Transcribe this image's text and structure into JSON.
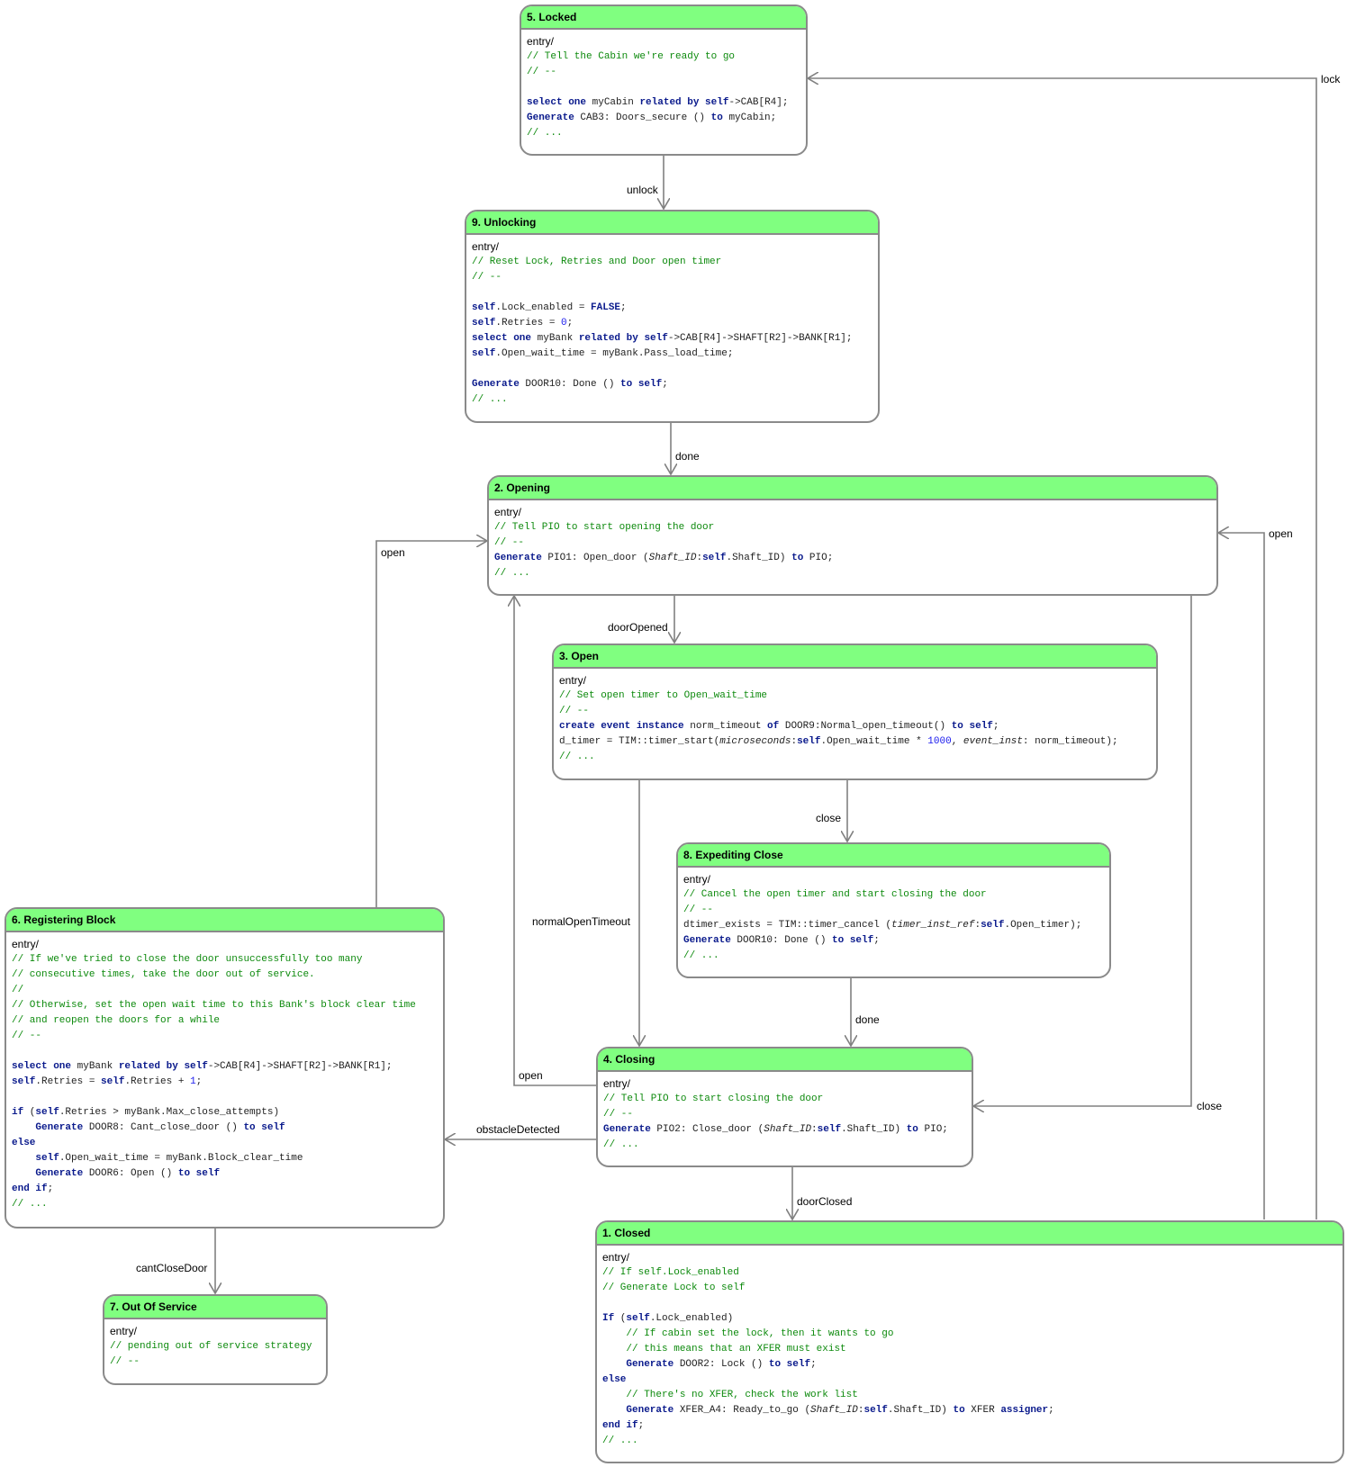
{
  "entry_label": "entry/",
  "states": [
    {
      "id": "locked",
      "title": "5. Locked",
      "code": [
        [
          [
            "c",
            "// Tell the Cabin we're ready to go"
          ]
        ],
        [
          [
            "c",
            "// --"
          ]
        ],
        [],
        [
          [
            "k",
            "select one"
          ],
          [
            "t",
            " myCabin "
          ],
          [
            "k",
            "related by self"
          ],
          [
            "t",
            "->CAB[R4];"
          ]
        ],
        [
          [
            "k",
            "Generate"
          ],
          [
            "t",
            " CAB3: Doors_secure () "
          ],
          [
            "k",
            "to"
          ],
          [
            "t",
            " myCabin;"
          ]
        ],
        [
          [
            "c",
            "// ..."
          ]
        ]
      ]
    },
    {
      "id": "unlocking",
      "title": "9. Unlocking",
      "code": [
        [
          [
            "c",
            "// Reset Lock, Retries and Door open timer"
          ]
        ],
        [
          [
            "c",
            "// --"
          ]
        ],
        [],
        [
          [
            "k",
            "self"
          ],
          [
            "t",
            ".Lock_enabled = "
          ],
          [
            "k",
            "FALSE"
          ],
          [
            "t",
            ";"
          ]
        ],
        [
          [
            "k",
            "self"
          ],
          [
            "t",
            ".Retries = "
          ],
          [
            "n",
            "0"
          ],
          [
            "t",
            ";"
          ]
        ],
        [
          [
            "k",
            "select one"
          ],
          [
            "t",
            " myBank "
          ],
          [
            "k",
            "related by self"
          ],
          [
            "t",
            "->CAB[R4]->SHAFT[R2]->BANK[R1];"
          ]
        ],
        [
          [
            "k",
            "self"
          ],
          [
            "t",
            ".Open_wait_time = myBank.Pass_load_time;"
          ]
        ],
        [],
        [
          [
            "k",
            "Generate"
          ],
          [
            "t",
            " DOOR10: Done () "
          ],
          [
            "k",
            "to self"
          ],
          [
            "t",
            ";"
          ]
        ],
        [
          [
            "c",
            "// ..."
          ]
        ]
      ]
    },
    {
      "id": "opening",
      "title": "2. Opening",
      "code": [
        [
          [
            "c",
            "// Tell PIO to start opening the door"
          ]
        ],
        [
          [
            "c",
            "// --"
          ]
        ],
        [
          [
            "k",
            "Generate"
          ],
          [
            "t",
            " PIO1: Open_door ("
          ],
          [
            "i",
            "Shaft_ID"
          ],
          [
            "t",
            ":"
          ],
          [
            "k",
            "self"
          ],
          [
            "t",
            ".Shaft_ID) "
          ],
          [
            "k",
            "to"
          ],
          [
            "t",
            " PIO;"
          ]
        ],
        [
          [
            "c",
            "// ..."
          ]
        ]
      ]
    },
    {
      "id": "open",
      "title": "3. Open",
      "code": [
        [
          [
            "c",
            "// Set open timer to Open_wait_time"
          ]
        ],
        [
          [
            "c",
            "// --"
          ]
        ],
        [
          [
            "k",
            "create event instance"
          ],
          [
            "t",
            " norm_timeout "
          ],
          [
            "k",
            "of"
          ],
          [
            "t",
            " DOOR9:Normal_open_timeout() "
          ],
          [
            "k",
            "to self"
          ],
          [
            "t",
            ";"
          ]
        ],
        [
          [
            "t",
            "d_timer = TIM::timer_start("
          ],
          [
            "i",
            "microseconds"
          ],
          [
            "t",
            ":"
          ],
          [
            "k",
            "self"
          ],
          [
            "t",
            ".Open_wait_time * "
          ],
          [
            "n",
            "1000"
          ],
          [
            "t",
            ", "
          ],
          [
            "i",
            "event_inst"
          ],
          [
            "t",
            ": norm_timeout);"
          ]
        ],
        [
          [
            "c",
            "// ..."
          ]
        ]
      ]
    },
    {
      "id": "expediting-close",
      "title": "8. Expediting Close",
      "code": [
        [
          [
            "c",
            "// Cancel the open timer and start closing the door"
          ]
        ],
        [
          [
            "c",
            "// --"
          ]
        ],
        [
          [
            "t",
            "dtimer_exists = TIM::timer_cancel ("
          ],
          [
            "i",
            "timer_inst_ref"
          ],
          [
            "t",
            ":"
          ],
          [
            "k",
            "self"
          ],
          [
            "t",
            ".Open_timer);"
          ]
        ],
        [
          [
            "k",
            "Generate"
          ],
          [
            "t",
            " DOOR10: Done () "
          ],
          [
            "k",
            "to self"
          ],
          [
            "t",
            ";"
          ]
        ],
        [
          [
            "c",
            "// ..."
          ]
        ]
      ]
    },
    {
      "id": "registering-block",
      "title": "6. Registering Block",
      "code": [
        [
          [
            "c",
            "// If we've tried to close the door unsuccessfully too many"
          ]
        ],
        [
          [
            "c",
            "// consecutive times, take the door out of service."
          ]
        ],
        [
          [
            "c",
            "//"
          ]
        ],
        [
          [
            "c",
            "// Otherwise, set the open wait time to this Bank's block clear time"
          ]
        ],
        [
          [
            "c",
            "// and reopen the doors for a while"
          ]
        ],
        [
          [
            "c",
            "// --"
          ]
        ],
        [],
        [
          [
            "k",
            "select one"
          ],
          [
            "t",
            " myBank "
          ],
          [
            "k",
            "related by self"
          ],
          [
            "t",
            "->CAB[R4]->SHAFT[R2]->BANK[R1];"
          ]
        ],
        [
          [
            "k",
            "self"
          ],
          [
            "t",
            ".Retries = "
          ],
          [
            "k",
            "self"
          ],
          [
            "t",
            ".Retries + "
          ],
          [
            "n",
            "1"
          ],
          [
            "t",
            ";"
          ]
        ],
        [],
        [
          [
            "k",
            "if"
          ],
          [
            "t",
            " ("
          ],
          [
            "k",
            "self"
          ],
          [
            "t",
            ".Retries > myBank.Max_close_attempts)"
          ]
        ],
        [
          [
            "t",
            "    "
          ],
          [
            "k",
            "Generate"
          ],
          [
            "t",
            " DOOR8: Cant_close_door () "
          ],
          [
            "k",
            "to self"
          ]
        ],
        [
          [
            "k",
            "else"
          ]
        ],
        [
          [
            "t",
            "    "
          ],
          [
            "k",
            "self"
          ],
          [
            "t",
            ".Open_wait_time = myBank.Block_clear_time"
          ]
        ],
        [
          [
            "t",
            "    "
          ],
          [
            "k",
            "Generate"
          ],
          [
            "t",
            " DOOR6: Open () "
          ],
          [
            "k",
            "to self"
          ]
        ],
        [
          [
            "k",
            "end if"
          ],
          [
            "t",
            ";"
          ]
        ],
        [
          [
            "c",
            "// ..."
          ]
        ]
      ]
    },
    {
      "id": "closing",
      "title": "4. Closing",
      "code": [
        [
          [
            "c",
            "// Tell PIO to start closing the door"
          ]
        ],
        [
          [
            "c",
            "// --"
          ]
        ],
        [
          [
            "k",
            "Generate"
          ],
          [
            "t",
            " PIO2: Close_door ("
          ],
          [
            "i",
            "Shaft_ID"
          ],
          [
            "t",
            ":"
          ],
          [
            "k",
            "self"
          ],
          [
            "t",
            ".Shaft_ID) "
          ],
          [
            "k",
            "to"
          ],
          [
            "t",
            " PIO;"
          ]
        ],
        [
          [
            "c",
            "// ..."
          ]
        ]
      ]
    },
    {
      "id": "out-of-service",
      "title": "7. Out Of Service",
      "code": [
        [
          [
            "c",
            "// pending out of service strategy"
          ]
        ],
        [
          [
            "c",
            "// --"
          ]
        ]
      ]
    },
    {
      "id": "closed",
      "title": "1. Closed",
      "code": [
        [
          [
            "c",
            "// If self.Lock_enabled"
          ]
        ],
        [
          [
            "c",
            "// Generate Lock to self"
          ]
        ],
        [],
        [
          [
            "k",
            "If"
          ],
          [
            "t",
            " ("
          ],
          [
            "k",
            "self"
          ],
          [
            "t",
            ".Lock_enabled)"
          ]
        ],
        [
          [
            "t",
            "    "
          ],
          [
            "c",
            "// If cabin set the lock, then it wants to go"
          ]
        ],
        [
          [
            "t",
            "    "
          ],
          [
            "c",
            "// this means that an XFER must exist"
          ]
        ],
        [
          [
            "t",
            "    "
          ],
          [
            "k",
            "Generate"
          ],
          [
            "t",
            " DOOR2: Lock () "
          ],
          [
            "k",
            "to self"
          ],
          [
            "t",
            ";"
          ]
        ],
        [
          [
            "k",
            "else"
          ]
        ],
        [
          [
            "t",
            "    "
          ],
          [
            "c",
            "// There's no XFER, check the work list"
          ]
        ],
        [
          [
            "t",
            "    "
          ],
          [
            "k",
            "Generate"
          ],
          [
            "t",
            " XFER_A4: Ready_to_go ("
          ],
          [
            "i",
            "Shaft_ID"
          ],
          [
            "t",
            ":"
          ],
          [
            "k",
            "self"
          ],
          [
            "t",
            ".Shaft_ID) "
          ],
          [
            "k",
            "to"
          ],
          [
            "t",
            " XFER "
          ],
          [
            "k",
            "assigner"
          ],
          [
            "t",
            ";"
          ]
        ],
        [
          [
            "k",
            "end if"
          ],
          [
            "t",
            ";"
          ]
        ],
        [
          [
            "c",
            "// ..."
          ]
        ]
      ]
    }
  ],
  "transitions": [
    {
      "id": "unlock",
      "label": "unlock"
    },
    {
      "id": "done-unlocking",
      "label": "done"
    },
    {
      "id": "door-opened",
      "label": "doorOpened"
    },
    {
      "id": "close-open",
      "label": "close"
    },
    {
      "id": "done-expediting",
      "label": "done"
    },
    {
      "id": "normal-open-timeout",
      "label": "normalOpenTimeout"
    },
    {
      "id": "open-closing",
      "label": "open"
    },
    {
      "id": "close-opening",
      "label": "close"
    },
    {
      "id": "obstacle-detected",
      "label": "obstacleDetected"
    },
    {
      "id": "door-closed",
      "label": "doorClosed"
    },
    {
      "id": "open-registering",
      "label": "open"
    },
    {
      "id": "cant-close-door",
      "label": "cantCloseDoor"
    },
    {
      "id": "open-closed",
      "label": "open"
    },
    {
      "id": "lock",
      "label": "lock"
    }
  ],
  "colors": {
    "header": "#80ff80",
    "border": "#8a8a8a",
    "keyword": "#0a1a8c",
    "comment": "#0d8a0d",
    "number": "#1a1aee",
    "arrow": "#808080"
  }
}
